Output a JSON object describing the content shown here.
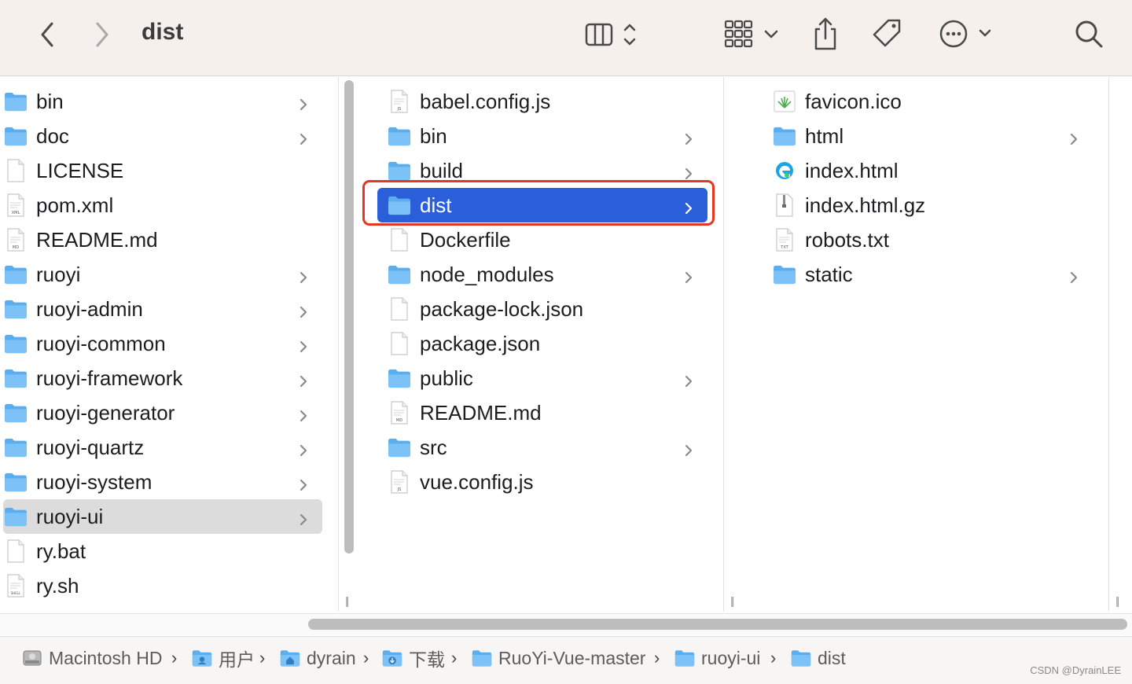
{
  "window": {
    "title": "dist"
  },
  "toolbar": {
    "back_icon": "chevron-left-icon",
    "forward_icon": "chevron-right-icon",
    "view_icon": "column-view-icon",
    "group_icon": "grid-group-icon",
    "share_icon": "share-icon",
    "tag_icon": "tag-icon",
    "more_icon": "ellipsis-circle-icon",
    "search_icon": "search-icon"
  },
  "column1": {
    "items": [
      {
        "name": "bin",
        "type": "folder",
        "chevron": true
      },
      {
        "name": "doc",
        "type": "folder",
        "chevron": true
      },
      {
        "name": "LICENSE",
        "type": "file",
        "chevron": false
      },
      {
        "name": "pom.xml",
        "type": "file",
        "badge": "XML",
        "chevron": false
      },
      {
        "name": "README.md",
        "type": "file",
        "badge": "MD",
        "chevron": false
      },
      {
        "name": "ruoyi",
        "type": "folder",
        "chevron": true
      },
      {
        "name": "ruoyi-admin",
        "type": "folder",
        "chevron": true
      },
      {
        "name": "ruoyi-common",
        "type": "folder",
        "chevron": true
      },
      {
        "name": "ruoyi-framework",
        "type": "folder",
        "chevron": true
      },
      {
        "name": "ruoyi-generator",
        "type": "folder",
        "chevron": true
      },
      {
        "name": "ruoyi-quartz",
        "type": "folder",
        "chevron": true
      },
      {
        "name": "ruoyi-system",
        "type": "folder",
        "chevron": true
      },
      {
        "name": "ruoyi-ui",
        "type": "folder",
        "chevron": true,
        "selected": "gray"
      },
      {
        "name": "ry.bat",
        "type": "file",
        "chevron": false
      },
      {
        "name": "ry.sh",
        "type": "file",
        "badge": "SHELL",
        "chevron": false
      }
    ]
  },
  "column2": {
    "items": [
      {
        "name": "babel.config.js",
        "type": "file",
        "badge": "JS",
        "chevron": false
      },
      {
        "name": "bin",
        "type": "folder",
        "chevron": true
      },
      {
        "name": "build",
        "type": "folder",
        "chevron": true
      },
      {
        "name": "dist",
        "type": "folder",
        "chevron": true,
        "selected": "blue"
      },
      {
        "name": "Dockerfile",
        "type": "file",
        "chevron": false
      },
      {
        "name": "node_modules",
        "type": "folder",
        "chevron": true
      },
      {
        "name": "package-lock.json",
        "type": "file",
        "chevron": false
      },
      {
        "name": "package.json",
        "type": "file",
        "chevron": false
      },
      {
        "name": "public",
        "type": "folder",
        "chevron": true
      },
      {
        "name": "README.md",
        "type": "file",
        "badge": "MD",
        "chevron": false
      },
      {
        "name": "src",
        "type": "folder",
        "chevron": true
      },
      {
        "name": "vue.config.js",
        "type": "file",
        "badge": "JS",
        "chevron": false
      }
    ]
  },
  "column3": {
    "items": [
      {
        "name": "favicon.ico",
        "type": "image",
        "chevron": false
      },
      {
        "name": "html",
        "type": "folder",
        "chevron": true
      },
      {
        "name": "index.html",
        "type": "edge",
        "chevron": false
      },
      {
        "name": "index.html.gz",
        "type": "archive",
        "chevron": false
      },
      {
        "name": "robots.txt",
        "type": "file",
        "badge": "TXT",
        "chevron": false
      },
      {
        "name": "static",
        "type": "folder",
        "chevron": true
      }
    ]
  },
  "pathbar": {
    "crumbs": [
      {
        "label": "Macintosh HD",
        "icon": "hard-drive-icon"
      },
      {
        "label": "用户",
        "icon": "users-folder-icon"
      },
      {
        "label": "dyrain",
        "icon": "home-folder-icon"
      },
      {
        "label": "下载",
        "icon": "downloads-folder-icon"
      },
      {
        "label": "RuoYi-Vue-master",
        "icon": "folder-icon"
      },
      {
        "label": "ruoyi-ui",
        "icon": "folder-icon"
      },
      {
        "label": "dist",
        "icon": "folder-icon"
      }
    ]
  },
  "watermark": "CSDN @DyrainLEE",
  "colors": {
    "selection_blue": "#2b5fd9",
    "highlight_red": "#e53524",
    "folder_blue": "#5aaef0"
  }
}
